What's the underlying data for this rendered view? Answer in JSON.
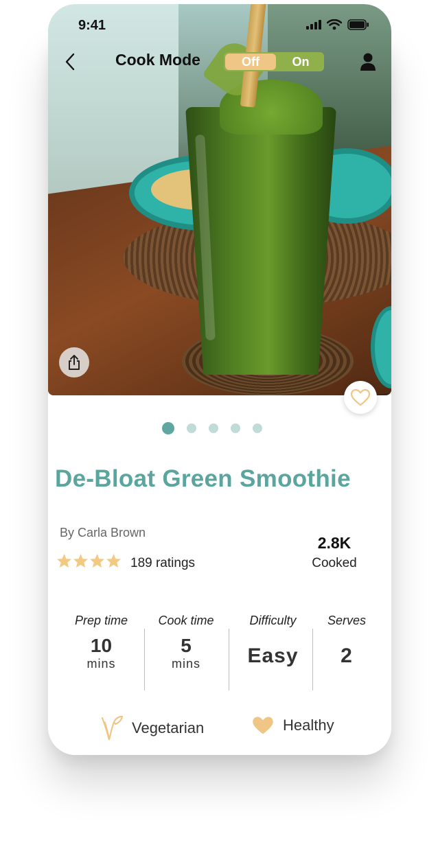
{
  "status_bar": {
    "time": "9:41"
  },
  "top_bar": {
    "cook_mode_label": "Cook Mode",
    "toggle_off": "Off",
    "toggle_on": "On"
  },
  "carousel": {
    "total_pages": 5,
    "current_page": 1
  },
  "recipe": {
    "title": "De-Bloat Green Smoothie",
    "author": "By Carla Brown",
    "star_rating": 4,
    "ratings_text": "189 ratings",
    "cooked_count": "2.8K",
    "cooked_label": "Cooked"
  },
  "stats": {
    "prep": {
      "label": "Prep time",
      "value": "10",
      "unit": "mins"
    },
    "cook": {
      "label": "Cook time",
      "value": "5",
      "unit": "mins"
    },
    "difficulty": {
      "label": "Difficulty",
      "value": "Easy"
    },
    "serves": {
      "label": "Serves",
      "value": "2"
    }
  },
  "tags": [
    {
      "label": "Vegetarian",
      "icon": "leaf-v-icon"
    },
    {
      "label": "Healthy",
      "icon": "heart-icon"
    }
  ],
  "colors": {
    "accent_teal": "#5aa59d",
    "star_gold": "#f0c983",
    "toggle_green": "#8fb04a",
    "toggle_off_bg": "#efc685"
  }
}
